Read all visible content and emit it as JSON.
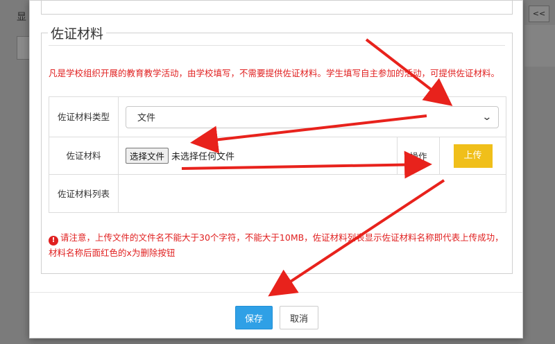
{
  "background": {
    "label_fragment": "显",
    "pager_label": "<<"
  },
  "section": {
    "legend": "佐证材料",
    "note": "凡是学校组织开展的教育教学活动，由学校填写，不需要提供佐证材料。学生填写自主参加的活动，可提供佐证材料。"
  },
  "form": {
    "type_label": "佐证材料类型",
    "type_value": "文件",
    "material_label": "佐证材料",
    "file_button": "选择文件",
    "file_status": "未选择任何文件",
    "op_label": "操作",
    "upload_button": "上传",
    "list_label": "佐证材料列表"
  },
  "warning": {
    "text": "请注意，上传文件的文件名不能大于30个字符，不能大于10MB，佐证材料列表显示佐证材料名称即代表上传成功，材料名称后面红色的x为删除按钮"
  },
  "footer": {
    "save": "保存",
    "cancel": "取消"
  },
  "colors": {
    "note_red": "#e02020",
    "upload_yellow": "#f0bf1a",
    "save_blue": "#2fa0e6",
    "arrow_red": "#e8221c"
  }
}
